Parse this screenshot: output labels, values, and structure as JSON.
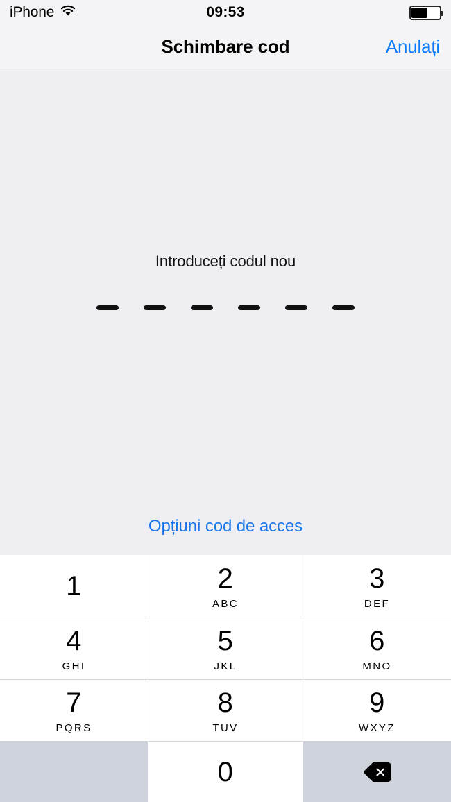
{
  "status_bar": {
    "carrier": "iPhone",
    "wifi_icon": "wifi-icon",
    "time": "09:53",
    "battery_icon": "battery-icon",
    "battery_level_percent": 57
  },
  "nav_bar": {
    "title": "Schimbare cod",
    "cancel_label": "Anulați",
    "cancel_color": "#0a7aff"
  },
  "content": {
    "prompt": "Introduceți codul nou",
    "passcode_length": 6,
    "entered_digits": 0,
    "options_link": "Opțiuni cod de acces",
    "options_link_color": "#1a76e8"
  },
  "keypad": {
    "keys": [
      {
        "digit": "1",
        "letters": ""
      },
      {
        "digit": "2",
        "letters": "ABC"
      },
      {
        "digit": "3",
        "letters": "DEF"
      },
      {
        "digit": "4",
        "letters": "GHI"
      },
      {
        "digit": "5",
        "letters": "JKL"
      },
      {
        "digit": "6",
        "letters": "MNO"
      },
      {
        "digit": "7",
        "letters": "PQRS"
      },
      {
        "digit": "8",
        "letters": "TUV"
      },
      {
        "digit": "9",
        "letters": "WXYZ"
      },
      {
        "digit": "0",
        "letters": ""
      }
    ],
    "delete_icon": "backspace-delete-icon",
    "blank_key_color": "#ced2db",
    "key_color": "#ffffff"
  },
  "colors": {
    "background": "#efeef3",
    "nav_background": "#f4f4f6",
    "accent_blue": "#0a7aff"
  }
}
